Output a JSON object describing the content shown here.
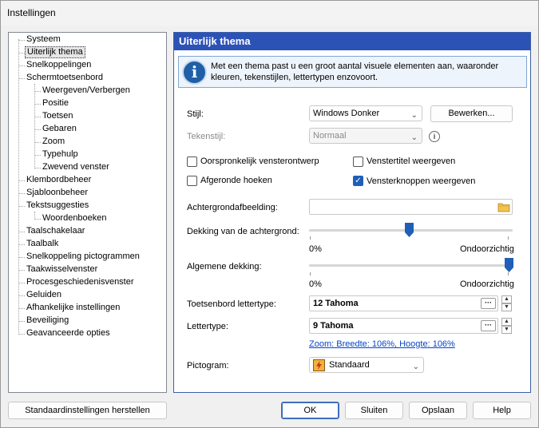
{
  "window": {
    "title": "Instellingen"
  },
  "tree": {
    "items": [
      {
        "label": "Systeem"
      },
      {
        "label": "Uiterlijk thema"
      },
      {
        "label": "Snelkoppelingen"
      },
      {
        "label": "Schermtoetsenbord"
      },
      {
        "label": "Weergeven/Verbergen"
      },
      {
        "label": "Positie"
      },
      {
        "label": "Toetsen"
      },
      {
        "label": "Gebaren"
      },
      {
        "label": "Zoom"
      },
      {
        "label": "Typehulp"
      },
      {
        "label": "Zwevend venster"
      },
      {
        "label": "Klembordbeheer"
      },
      {
        "label": "Sjabloonbeheer"
      },
      {
        "label": "Tekstsuggesties"
      },
      {
        "label": "Woordenboeken"
      },
      {
        "label": "Taalschakelaar"
      },
      {
        "label": "Taalbalk"
      },
      {
        "label": "Snelkoppeling pictogrammen"
      },
      {
        "label": "Taakwisselvenster"
      },
      {
        "label": "Procesgeschiedenisvenster"
      },
      {
        "label": "Geluiden"
      },
      {
        "label": "Afhankelijke instellingen"
      },
      {
        "label": "Beveiliging"
      },
      {
        "label": "Geavanceerde opties"
      }
    ],
    "selected": "Uiterlijk thema"
  },
  "panel": {
    "title": "Uiterlijk thema",
    "info": "Met een thema past u een groot aantal visuele elementen aan, waaronder kleuren, tekenstijlen, lettertypen enzovoort.",
    "style_label": "Stijl:",
    "style_value": "Windows Donker",
    "edit_button": "Bewerken...",
    "charstyle_label": "Tekenstijl:",
    "charstyle_value": "Normaal",
    "cb_original": "Oorspronkelijk vensterontwerp",
    "cb_title": "Venstertitel weergeven",
    "cb_rounded": "Afgeronde hoeken",
    "cb_buttons": "Vensterknoppen weergeven",
    "cb_states": {
      "original": false,
      "title": false,
      "rounded": false,
      "buttons": true
    },
    "bg_image_label": "Achtergrondafbeelding:",
    "bg_image_value": "",
    "bg_opacity_label": "Dekking van de achtergrond:",
    "bg_opacity_min": "0%",
    "bg_opacity_max": "Ondoorzichtig",
    "bg_opacity_value": 0.5,
    "general_opacity_label": "Algemene dekking:",
    "general_opacity_min": "0%",
    "general_opacity_max": "Ondoorzichtig",
    "general_opacity_value": 1.0,
    "kb_font_label": "Toetsenbord lettertype:",
    "kb_font_value": "12 Tahoma",
    "font_label": "Lettertype:",
    "font_value": "9 Tahoma",
    "zoom_link": "Zoom: Breedte: 106%, Hoogte: 106%",
    "icon_label": "Pictogram:",
    "icon_value": "Standaard"
  },
  "footer": {
    "reset": "Standaardinstellingen herstellen",
    "ok": "OK",
    "close": "Sluiten",
    "save": "Opslaan",
    "help": "Help"
  },
  "colors": {
    "header": "#2d52b6",
    "accent": "#1f5fb8",
    "link": "#0645c7"
  }
}
